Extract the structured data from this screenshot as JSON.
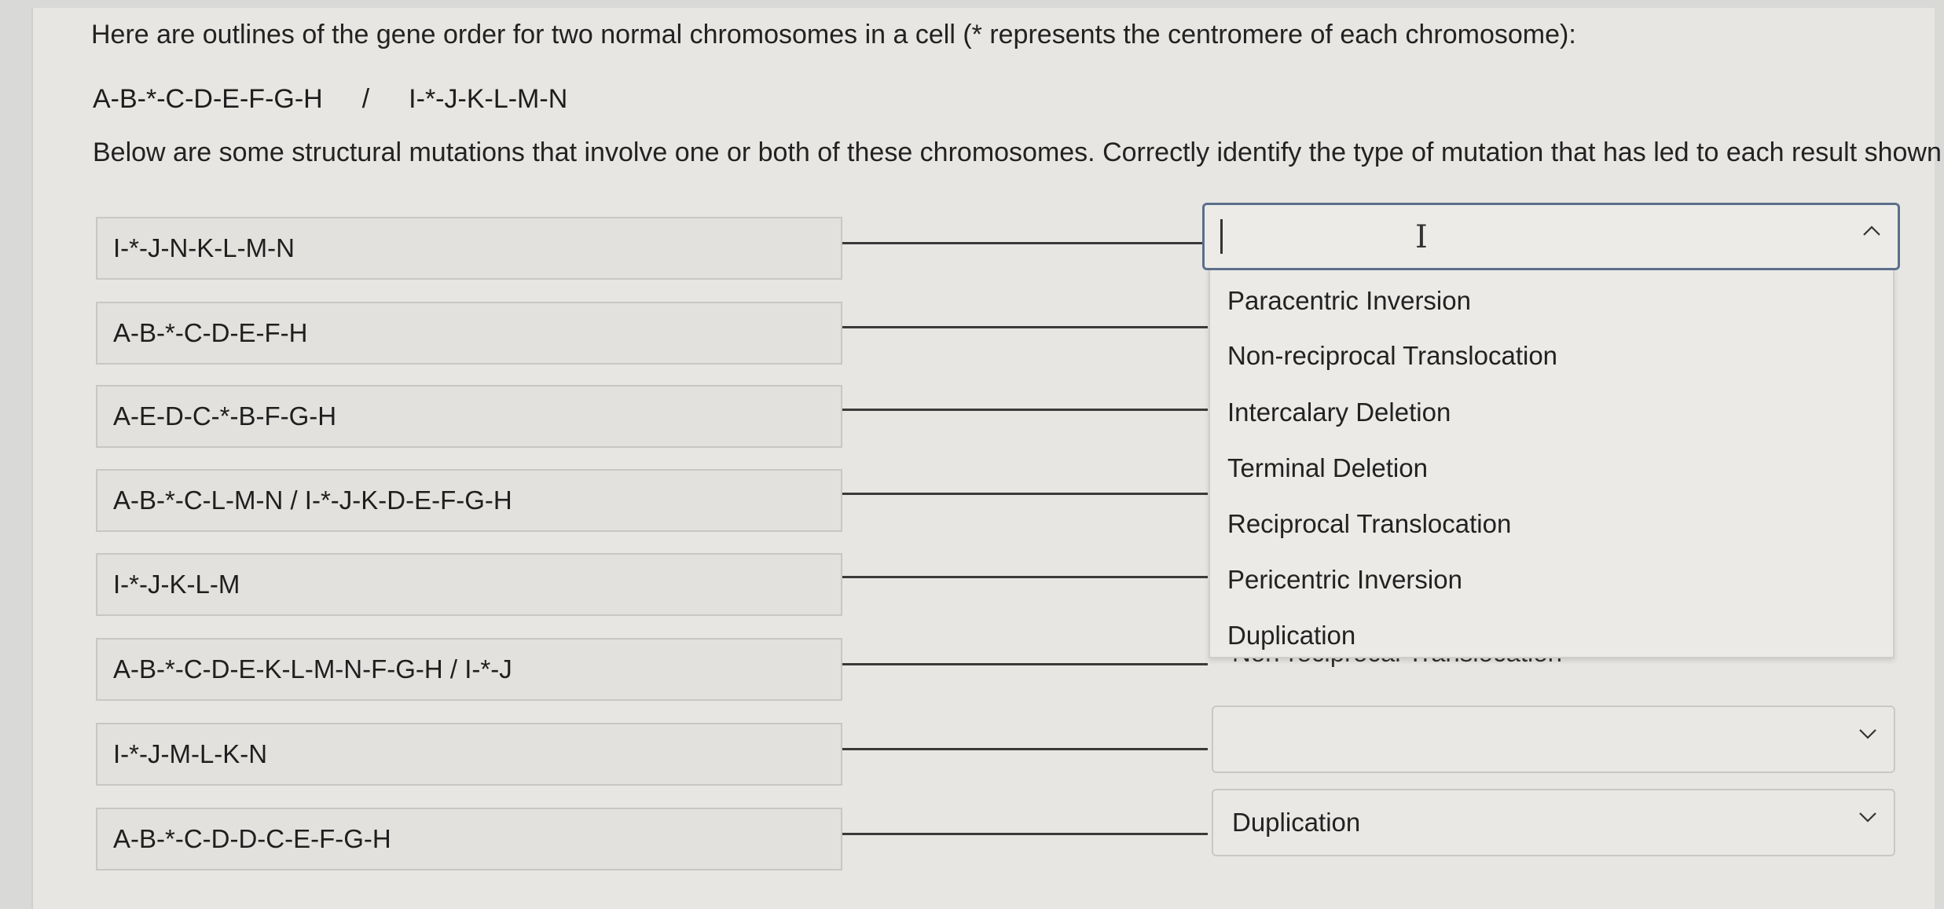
{
  "intro_text": "Here are outlines of the gene order for two normal chromosomes in a cell (* represents the centromere of each chromosome):",
  "chromosomes": {
    "first": "A-B-*-C-D-E-F-G-H",
    "separator": "/",
    "second": "I-*-J-K-L-M-N"
  },
  "instruction": "Below are some structural mutations that involve one or both of these chromosomes. Correctly identify the type of mutation that has led to each result shown.",
  "prompts": [
    "I-*-J-N-K-L-M-N",
    "A-B-*-C-D-E-F-H",
    "A-E-D-C-*-B-F-G-H",
    "A-B-*-C-L-M-N / I-*-J-K-D-E-F-G-H",
    "I-*-J-K-L-M",
    "A-B-*-C-D-E-K-L-M-N-F-G-H / I-*-J",
    "I-*-J-M-L-K-N",
    "A-B-*-C-D-D-C-E-F-G-H"
  ],
  "answers": [
    "",
    "",
    "",
    "",
    "",
    "Non-reciprocal Translocation",
    "",
    "Duplication"
  ],
  "dropdown_options": [
    "Paracentric Inversion",
    "Non-reciprocal Translocation",
    "Intercalary Deletion",
    "Terminal Deletion",
    "Reciprocal Translocation",
    "Pericentric Inversion",
    "Duplication"
  ],
  "icons": {
    "expand": "chevron-up-icon",
    "collapse": "chevron-down-icon",
    "cursor": "text-cursor-icon"
  }
}
